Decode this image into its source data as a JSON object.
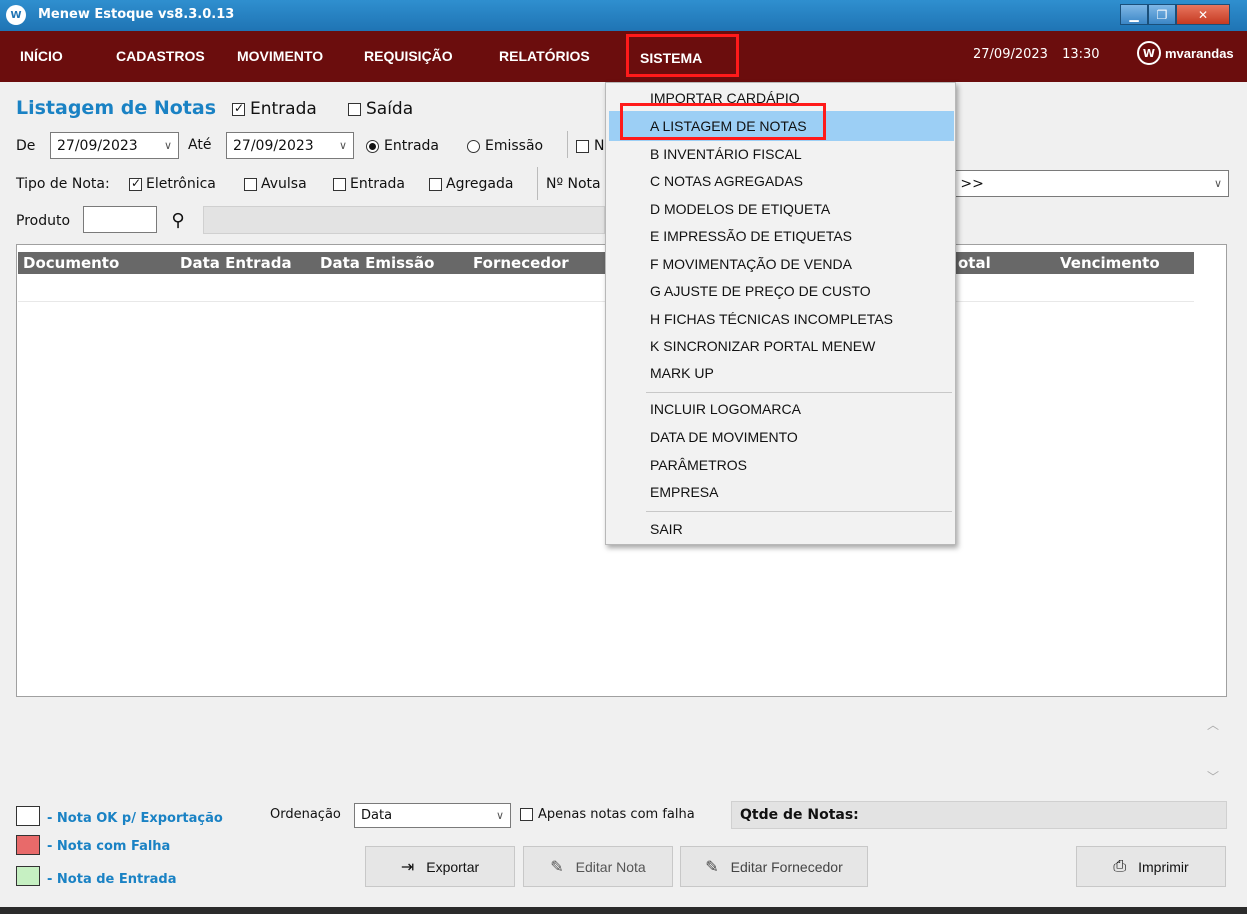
{
  "window": {
    "title": "Menew Estoque vs8.3.0.13",
    "icon": "W"
  },
  "menu": {
    "items": [
      "INÍCIO",
      "CADASTROS",
      "MOVIMENTO",
      "REQUISIÇÃO",
      "RELATÓRIOS",
      "SISTEMA"
    ],
    "date": "27/09/2023",
    "time": "13:30",
    "brand": "mvarandas",
    "brand_icon": "W"
  },
  "filters": {
    "title": "Listagem de Notas",
    "entrada_label": "Entrada",
    "saida_label": "Saída",
    "de_label": "De",
    "de_value": "27/09/2023",
    "ate_label": "Até",
    "ate_value": "27/09/2023",
    "radio_entrada": "Entrada",
    "radio_emissao": "Emissão",
    "partial_n": "N",
    "tipo_label": "Tipo de Nota:",
    "tipo_eletronica": "Eletrônica",
    "tipo_avulsa": "Avulsa",
    "tipo_entrada": "Entrada",
    "tipo_agregada": "Agregada",
    "nota_label": "Nº Nota",
    "fornecedor_partial": "S >>",
    "produto_label": "Produto",
    "search_icon": "search-icon"
  },
  "table": {
    "columns": [
      "Documento",
      "Data Entrada",
      "Data Emissão",
      "Fornecedor",
      "otal",
      "Vencimento"
    ]
  },
  "dropdown": {
    "items": [
      "IMPORTAR CARDÁPIO",
      "A LISTAGEM DE NOTAS",
      "B INVENTÁRIO FISCAL",
      "C NOTAS AGREGADAS",
      "D MODELOS DE ETIQUETA",
      "E IMPRESSÃO DE ETIQUETAS",
      "F MOVIMENTAÇÃO DE VENDA",
      "G AJUSTE DE PREÇO DE CUSTO",
      "H FICHAS TÉCNICAS INCOMPLETAS",
      "K SINCRONIZAR PORTAL MENEW",
      "MARK UP",
      "INCLUIR LOGOMARCA",
      "DATA DE MOVIMENTO",
      "PARÂMETROS",
      "EMPRESA",
      "SAIR"
    ],
    "selected": "A LISTAGEM DE NOTAS"
  },
  "legend": {
    "ok": "- Nota OK p/ Exportação",
    "falha": "- Nota com Falha",
    "entrada": "- Nota de Entrada",
    "colors": {
      "ok": "#ffffff",
      "falha": "#e86a6a",
      "entrada": "#c6f0c2"
    }
  },
  "bottom": {
    "ordenacao_label": "Ordenação",
    "ordenacao_value": "Data",
    "apenas_falha": "Apenas notas com falha",
    "qtde_label": "Qtde de Notas:",
    "buttons": {
      "exportar": "Exportar",
      "editar_nota": "Editar Nota",
      "editar_fornecedor": "Editar Fornecedor",
      "imprimir": "Imprimir"
    }
  },
  "colors": {
    "menubar": "#6b0d0d",
    "accent": "#1a82c4",
    "highlight": "#ff1a1a",
    "selection": "#9ccff5"
  }
}
